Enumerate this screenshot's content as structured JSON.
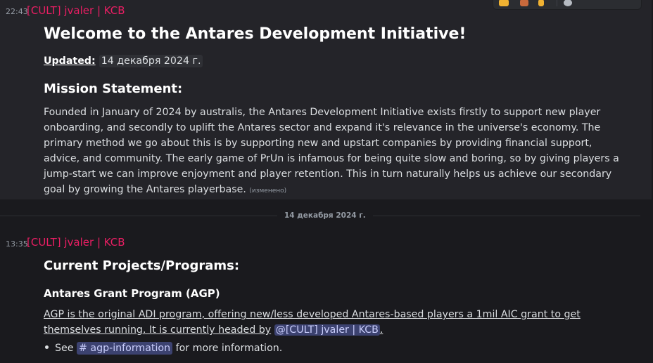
{
  "message1": {
    "time": "22:43",
    "author": "[CULT] jvaler | KCB",
    "title": "Welcome to the Antares Development Initiative!",
    "updated_label": "Updated:",
    "updated_date": "14 декабря 2024 г.",
    "mission_heading": "Mission Statement:",
    "mission_text": "Founded in January of 2024 by australis, the Antares Development Initiative exists firstly to support new player onboarding, and secondly to uplift the Antares sector and expand it's relevance in the universe's economy. The primary method we go about this is by supporting new and upstart companies by providing financial support, advice, and community. The early game of PrUn is infamous for being quite slow and boring, so by giving players a jump-start we can improve enjoyment and player retention. This in turn naturally helps us achieve our secondary goal by growing the Antares playerbase.",
    "edited": "(изменено)"
  },
  "divider": {
    "date": "14 декабря 2024 г."
  },
  "message2": {
    "time": "13:35",
    "author": "[CULT] jvaler | KCB",
    "heading": "Current Projects/Programs:",
    "program_title": "Antares Grant Program (AGP)",
    "program_text": "AGP is the original ADI program, offering new/less developed Antares-based players a 1mil AIC grant to get themselves running. It is currently headed by",
    "mention": "@[CULT] jvaler | KCB",
    "period": ".",
    "bullet_see": "See",
    "channel": "# agp-information",
    "bullet_rest": "for more information."
  },
  "colors": {
    "author": "#e91e63",
    "mention_bg": "#3c4270",
    "background": "#1a1a1e"
  },
  "toolbar": {
    "icons": [
      "emoji-icon",
      "reaction-icon",
      "reaction-icon",
      "reply-icon"
    ]
  }
}
